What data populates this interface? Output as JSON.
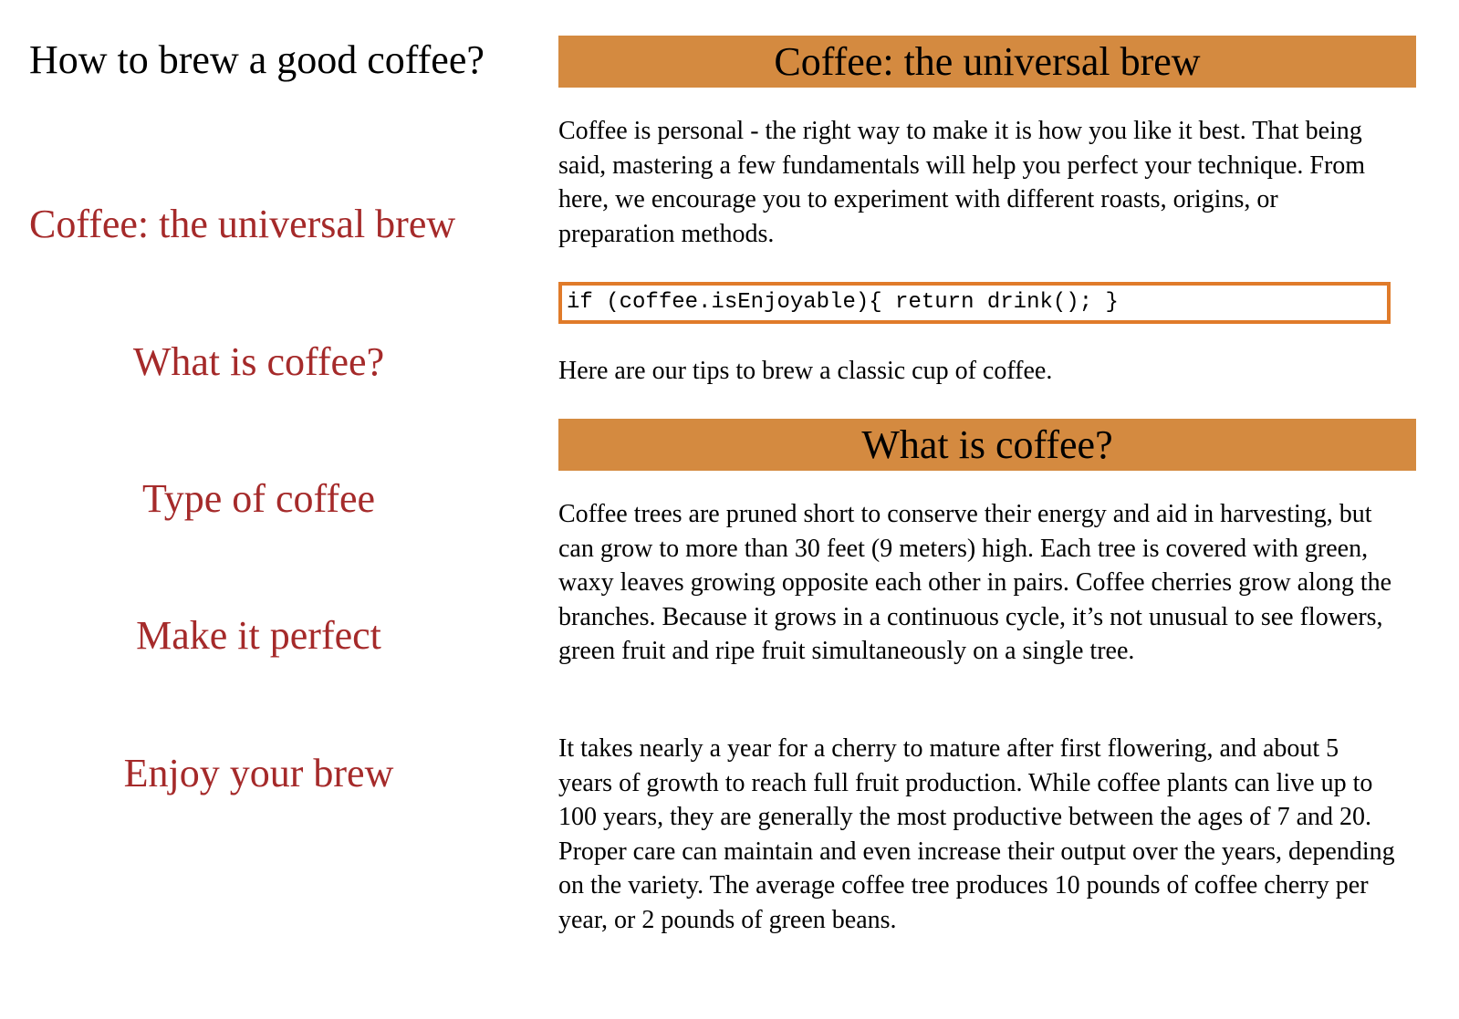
{
  "nav": {
    "title": "How to brew a good coffee?",
    "links": [
      "Coffee: the universal brew",
      "What is coffee?",
      "Type of coffee",
      "Make it perfect",
      "Enjoy your brew"
    ]
  },
  "sections": [
    {
      "heading": "Coffee: the universal brew",
      "intro": "Coffee is personal - the right way to make it is how you like it best. That being said, mastering a few fundamentals will help you perfect your technique. From here, we encourage you to experiment with different roasts, origins, or preparation methods.",
      "code": "if (coffee.isEnjoyable){ return drink(); }",
      "tips": "Here are our tips to brew a classic cup of coffee."
    },
    {
      "heading": "What is coffee?",
      "para1": "Coffee trees are pruned short to conserve their energy and aid in harvesting, but can grow to more than 30 feet (9 meters) high. Each tree is covered with green, waxy leaves growing opposite each other in pairs. Coffee cherries grow along the branches. Because it grows in a continuous cycle, it’s not unusual to see flowers, green fruit and ripe fruit simultaneously on a single tree.",
      "para2": "It takes nearly a year for a cherry to mature after first flowering, and about 5 years of growth to reach full fruit production. While coffee plants can live up to 100 years, they are generally the most productive between the ages of 7 and 20. Proper care can maintain and even increase their output over the years, depending on the variety. The average coffee tree produces 10 pounds of coffee cherry per year, or 2 pounds of green beans."
    }
  ],
  "colors": {
    "link": "#a52a2a",
    "heading_bg": "#d48a40",
    "code_border": "#e07b2a"
  }
}
